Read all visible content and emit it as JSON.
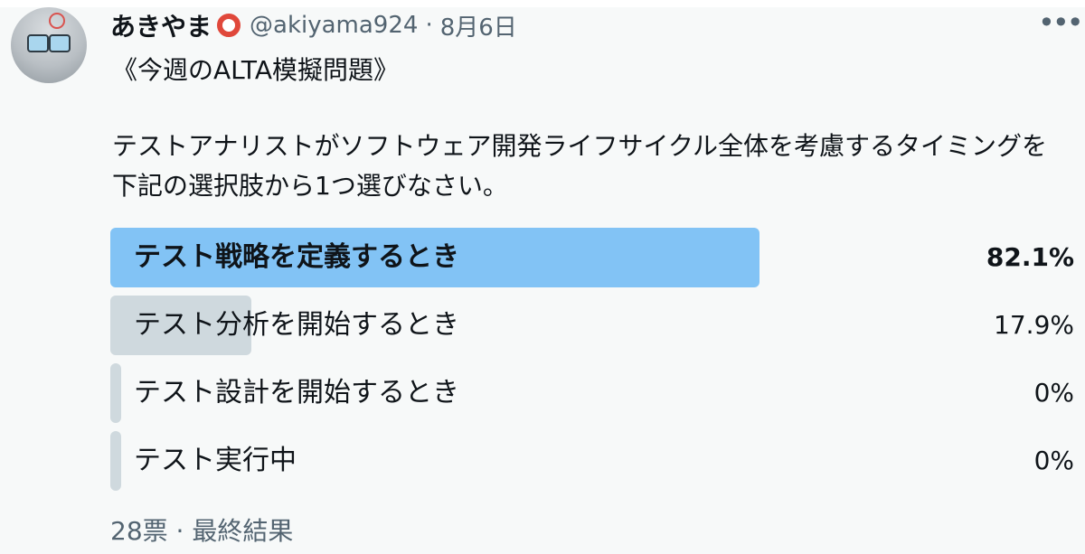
{
  "tweet": {
    "author_name": "あきやま",
    "author_handle": "@akiyama924",
    "separator": "·",
    "date": "8月6日",
    "title": "《今週のALTA模擬問題》",
    "question": "テストアナリストがソフトウェア開発ライフサイクル全体を考慮するタイミングを下記の選択肢から1つ選びなさい。"
  },
  "poll": {
    "options": [
      {
        "label": "テスト戦略を定義するとき",
        "percent_text": "82.1%",
        "percent": 82.1,
        "winner": true
      },
      {
        "label": "テスト分析を開始するとき",
        "percent_text": "17.9%",
        "percent": 17.9,
        "winner": false
      },
      {
        "label": "テスト設計を開始するとき",
        "percent_text": "0%",
        "percent": 0,
        "winner": false
      },
      {
        "label": "テスト実行中",
        "percent_text": "0%",
        "percent": 0,
        "winner": false
      }
    ],
    "votes": "28票",
    "status": "最終結果"
  },
  "colors": {
    "winner_bar": "#82c3f5",
    "other_bar": "#cfd9de",
    "muted_text": "#536471"
  },
  "icons": {
    "more": "more-dots-icon",
    "badge": "lifebuoy-icon"
  }
}
